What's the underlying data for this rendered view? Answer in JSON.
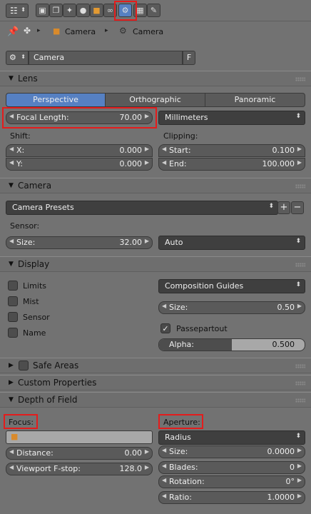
{
  "header": {
    "tabs": [
      "render",
      "render-layers",
      "scene",
      "world",
      "object",
      "constraints",
      "modifiers",
      "data",
      "material",
      "texture"
    ],
    "active_tab": "data"
  },
  "breadcrumb": {
    "pin": "pin-icon",
    "items": [
      {
        "icon": "object-data-icon",
        "label": ""
      },
      {
        "icon": "cube-icon",
        "label": "Camera"
      },
      {
        "icon": "camera-icon",
        "label": "Camera"
      }
    ]
  },
  "datablock": {
    "name": "Camera",
    "fake_user": "F"
  },
  "lens": {
    "title": "Lens",
    "types": [
      "Perspective",
      "Orthographic",
      "Panoramic"
    ],
    "active_type": "Perspective",
    "focal_length_label": "Focal Length:",
    "focal_length_value": "70.00",
    "unit": "Millimeters",
    "shift_label": "Shift:",
    "shift_x_label": "X:",
    "shift_x": "0.000",
    "shift_y_label": "Y:",
    "shift_y": "0.000",
    "clipping_label": "Clipping:",
    "clip_start_label": "Start:",
    "clip_start": "0.100",
    "clip_end_label": "End:",
    "clip_end": "100.000"
  },
  "camera": {
    "title": "Camera",
    "presets": "Camera Presets",
    "sensor_label": "Sensor:",
    "size_label": "Size:",
    "size_value": "32.00",
    "fit": "Auto"
  },
  "display": {
    "title": "Display",
    "checks": [
      {
        "label": "Limits",
        "checked": false
      },
      {
        "label": "Mist",
        "checked": false
      },
      {
        "label": "Sensor",
        "checked": false
      },
      {
        "label": "Name",
        "checked": false
      }
    ],
    "guides": "Composition Guides",
    "size_label": "Size:",
    "size_value": "0.50",
    "passepartout_label": "Passepartout",
    "passepartout": true,
    "alpha_label": "Alpha:",
    "alpha_value": "0.500",
    "alpha_fraction": 0.5
  },
  "safe_areas": {
    "title": "Safe Areas"
  },
  "custom_properties": {
    "title": "Custom Properties"
  },
  "dof": {
    "title": "Depth of Field",
    "focus_label": "Focus:",
    "distance_label": "Distance:",
    "distance_value": "0.00",
    "fstop_label": "Viewport F-stop:",
    "fstop_value": "128.0",
    "aperture_label": "Aperture:",
    "aperture_type": "Radius",
    "size_label": "Size:",
    "size_value": "0.0000",
    "blades_label": "Blades:",
    "blades_value": "0",
    "rotation_label": "Rotation:",
    "rotation_value": "0°",
    "ratio_label": "Ratio:",
    "ratio_value": "1.0000"
  },
  "colors": {
    "accent": "#5680c2",
    "highlight_box": "#e41c1c",
    "panel_bg": "#727272"
  }
}
